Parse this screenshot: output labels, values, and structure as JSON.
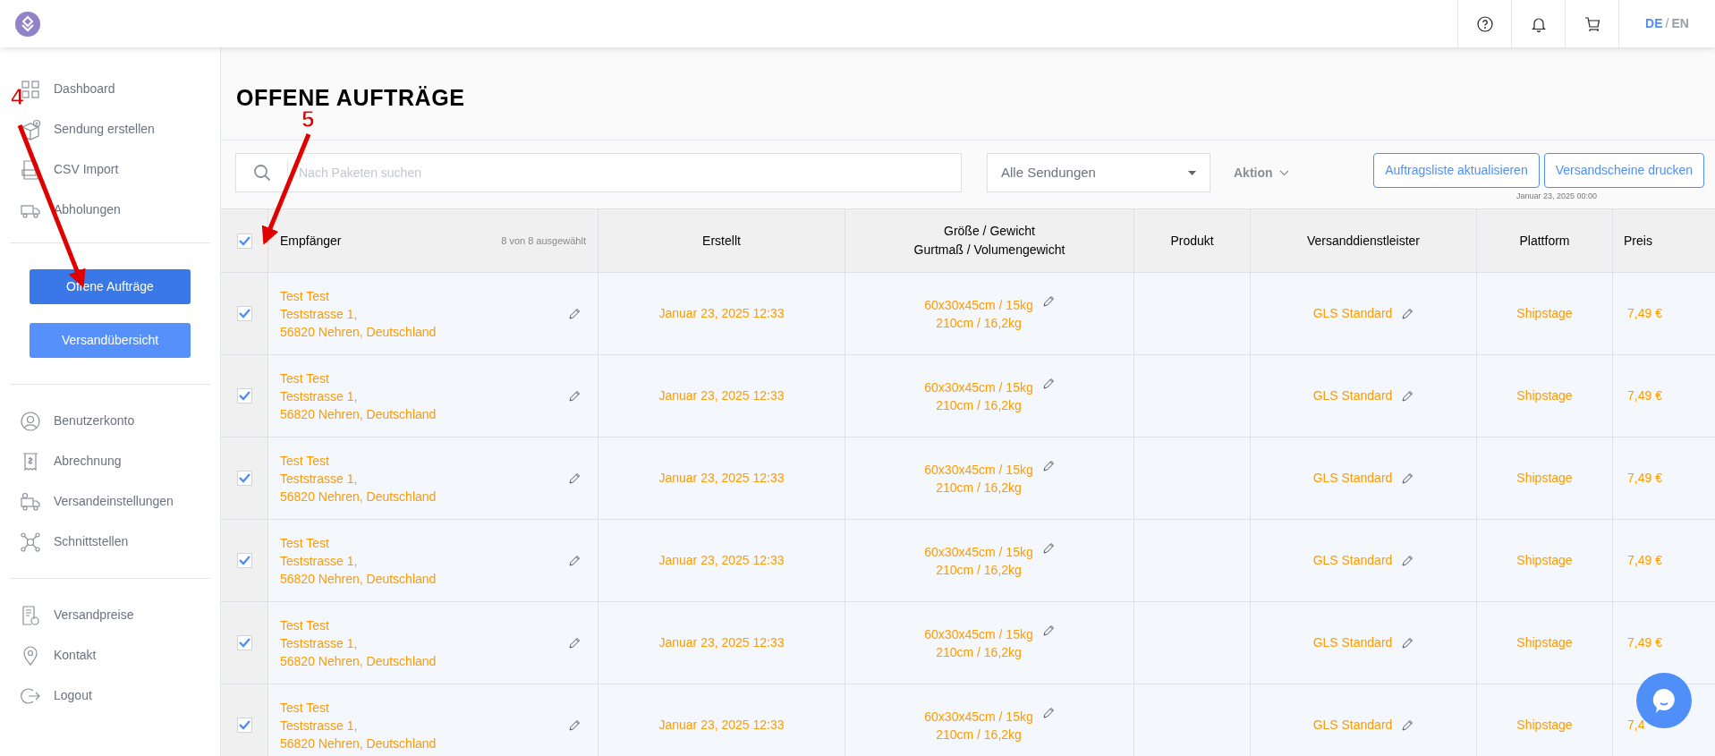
{
  "header": {
    "languages": [
      {
        "label": "DE",
        "selected": true
      },
      {
        "label": "EN",
        "selected": false
      }
    ],
    "separator": "/"
  },
  "sidebar": {
    "groups": [
      [
        {
          "label": "Dashboard"
        },
        {
          "label": "Sendung erstellen"
        },
        {
          "label": "CSV Import"
        },
        {
          "label": "Abholungen"
        }
      ],
      [
        {
          "label": "Benutzerkonto"
        },
        {
          "label": "Abrechnung"
        },
        {
          "label": "Versandeinstellungen"
        },
        {
          "label": "Schnittstellen"
        }
      ],
      [
        {
          "label": "Versandpreise"
        },
        {
          "label": "Kontakt"
        },
        {
          "label": "Logout"
        }
      ]
    ],
    "buttons": [
      {
        "label": "Offene Aufträge",
        "selected": true
      },
      {
        "label": "Versandübersicht",
        "selected": false
      }
    ]
  },
  "page_title": "OFFENE AUFTRÄGE",
  "toolbar": {
    "search_placeholder": "Nach Paketen suchen",
    "filter": "Alle Sendungen",
    "action": "Aktion",
    "buttons": [
      "Auftragsliste aktualisieren",
      "Versandscheine drucken"
    ],
    "timestamp": "Januar 23, 2025 00:00"
  },
  "table": {
    "select_all": {
      "checked": true
    },
    "selection_count": "8 von 8 ausgewählt",
    "columns": [
      [
        "Empfänger"
      ],
      [
        "Erstellt"
      ],
      [
        "Größe / Gewicht",
        "Gurtmaß / Volumengewicht"
      ],
      [
        "Produkt"
      ],
      [
        "Versanddienstleister"
      ],
      [
        "Plattform"
      ],
      [
        "Preis"
      ]
    ],
    "rows": [
      {
        "checked": true,
        "recipient": [
          "Test Test",
          "Teststrasse 1,",
          "56820 Nehren, Deutschland"
        ],
        "created": "Januar 23, 2025 12:33",
        "size": "60x30x45cm / 15kg",
        "girth": "210cm / 16,2kg",
        "carrier": "GLS Standard",
        "platform": "Shipstage",
        "price": "7,49 €"
      },
      {
        "checked": true,
        "recipient": [
          "Test Test",
          "Teststrasse 1,",
          "56820 Nehren, Deutschland"
        ],
        "created": "Januar 23, 2025 12:33",
        "size": "60x30x45cm / 15kg",
        "girth": "210cm / 16,2kg",
        "carrier": "GLS Standard",
        "platform": "Shipstage",
        "price": "7,49 €"
      },
      {
        "checked": true,
        "recipient": [
          "Test Test",
          "Teststrasse 1,",
          "56820 Nehren, Deutschland"
        ],
        "created": "Januar 23, 2025 12:33",
        "size": "60x30x45cm / 15kg",
        "girth": "210cm / 16,2kg",
        "carrier": "GLS Standard",
        "platform": "Shipstage",
        "price": "7,49 €"
      },
      {
        "checked": true,
        "recipient": [
          "Test Test",
          "Teststrasse 1,",
          "56820 Nehren, Deutschland"
        ],
        "created": "Januar 23, 2025 12:33",
        "size": "60x30x45cm / 15kg",
        "girth": "210cm / 16,2kg",
        "carrier": "GLS Standard",
        "platform": "Shipstage",
        "price": "7,49 €"
      },
      {
        "checked": true,
        "recipient": [
          "Test Test",
          "Teststrasse 1,",
          "56820 Nehren, Deutschland"
        ],
        "created": "Januar 23, 2025 12:33",
        "size": "60x30x45cm / 15kg",
        "girth": "210cm / 16,2kg",
        "carrier": "GLS Standard",
        "platform": "Shipstage",
        "price": "7,49 €"
      },
      {
        "checked": true,
        "recipient": [
          "Test Test",
          "Teststrasse 1,",
          "56820 Nehren, Deutschland"
        ],
        "created": "Januar 23, 2025 12:33",
        "size": "60x30x45cm / 15kg",
        "girth": "210cm / 16,2kg",
        "carrier": "GLS Standard",
        "platform": "Shipstage",
        "price": "7,4"
      }
    ]
  },
  "annotations": [
    {
      "label": "4"
    },
    {
      "label": "5"
    }
  ]
}
